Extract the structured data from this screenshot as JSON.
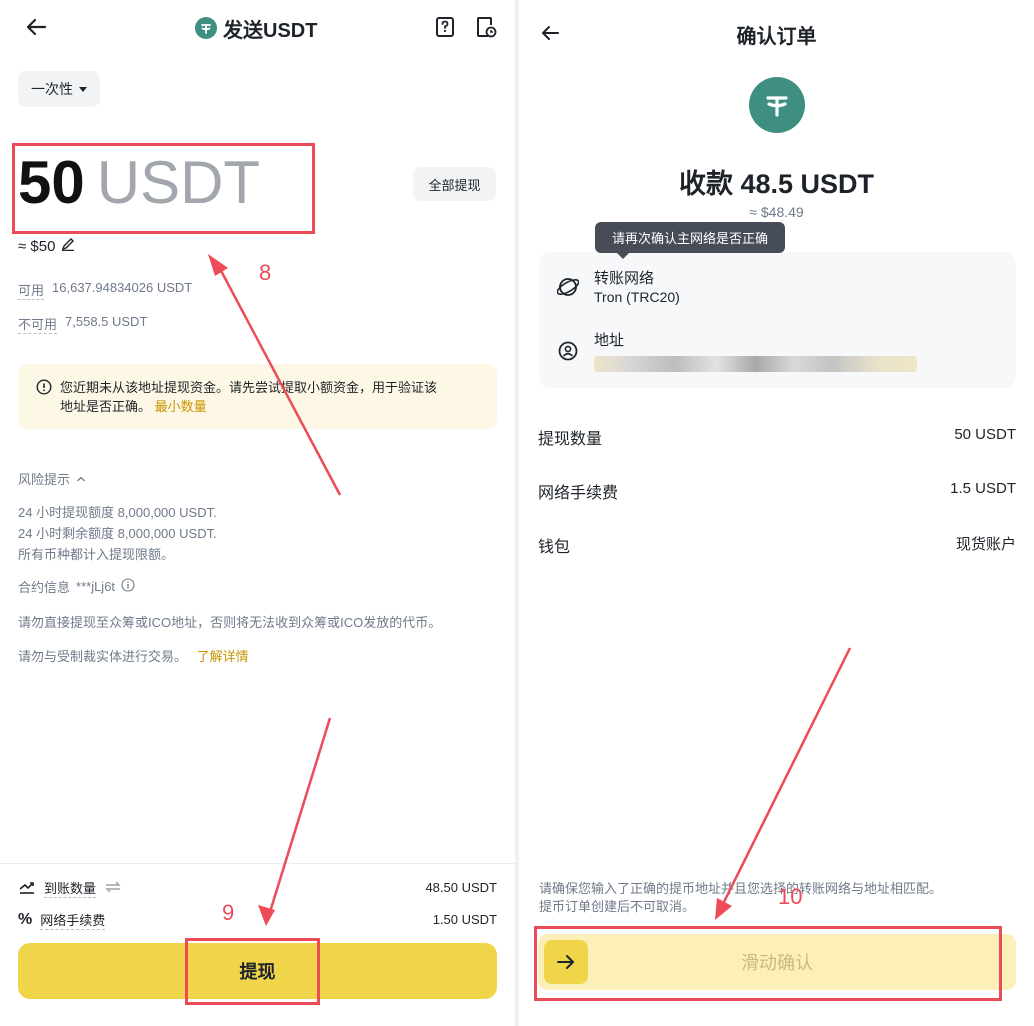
{
  "left": {
    "header": {
      "title": "发送USDT",
      "back_icon": "arrow-left-icon",
      "help_icon": "help-book-icon",
      "history_icon": "history-doc-icon"
    },
    "frequency": {
      "label": "一次性"
    },
    "amount": {
      "value": "50",
      "unit": "USDT",
      "fiat": "≈ $50",
      "all_button": "全部提现"
    },
    "balances": [
      {
        "label": "可用",
        "value": "16,637.94834026 USDT"
      },
      {
        "label": "不可用",
        "value": "7,558.5 USDT"
      }
    ],
    "notice": {
      "text_line1": "您近期未从该地址提现资金。请先尝试提取小额资金，用于验证该",
      "text_line2": "地址是否正确。",
      "link": "最小数量"
    },
    "risk": {
      "title": "风险提示",
      "lines": [
        "24 小时提现额度 8,000,000 USDT.",
        "24 小时剩余额度 8,000,000 USDT.",
        "所有币种都计入提现限额。"
      ],
      "contract_label": "合约信息",
      "contract_value": "***jLj6t",
      "warning1": "请勿直接提现至众筹或ICO地址，否则将无法收到众筹或ICO发放的代币。",
      "warning2": "请勿与受制裁实体进行交易。",
      "learn_more": "了解详情"
    },
    "footer": {
      "received_label": "到账数量",
      "received_value": "48.50 USDT",
      "fee_label": "网络手续费",
      "fee_value": "1.50 USDT",
      "submit": "提现"
    },
    "annotations": {
      "step8": "8",
      "step9": "9"
    }
  },
  "right": {
    "header": {
      "title": "确认订单"
    },
    "amount": {
      "title": "收款 48.5 USDT",
      "fiat": "≈ $48.49"
    },
    "tooltip": "请再次确认主网络是否正确",
    "network": {
      "label": "转账网络",
      "value": "Tron (TRC20)"
    },
    "address": {
      "label": "地址"
    },
    "rows": [
      {
        "label": "提现数量",
        "value": "50 USDT"
      },
      {
        "label": "网络手续费",
        "value": "1.5 USDT"
      },
      {
        "label": "钱包",
        "value": "现货账户"
      }
    ],
    "disclaimer": {
      "line1": "请确保您输入了正确的提币地址并且您选择的转账网络与地址相匹配。",
      "line2": "提币订单创建后不可取消。"
    },
    "slider": {
      "label": "滑动确认"
    },
    "annotations": {
      "step10": "10"
    }
  },
  "colors": {
    "accent": "#f0d54b",
    "tether": "#3e8f81",
    "annotation": "#ec4b57",
    "link": "#c99400"
  }
}
